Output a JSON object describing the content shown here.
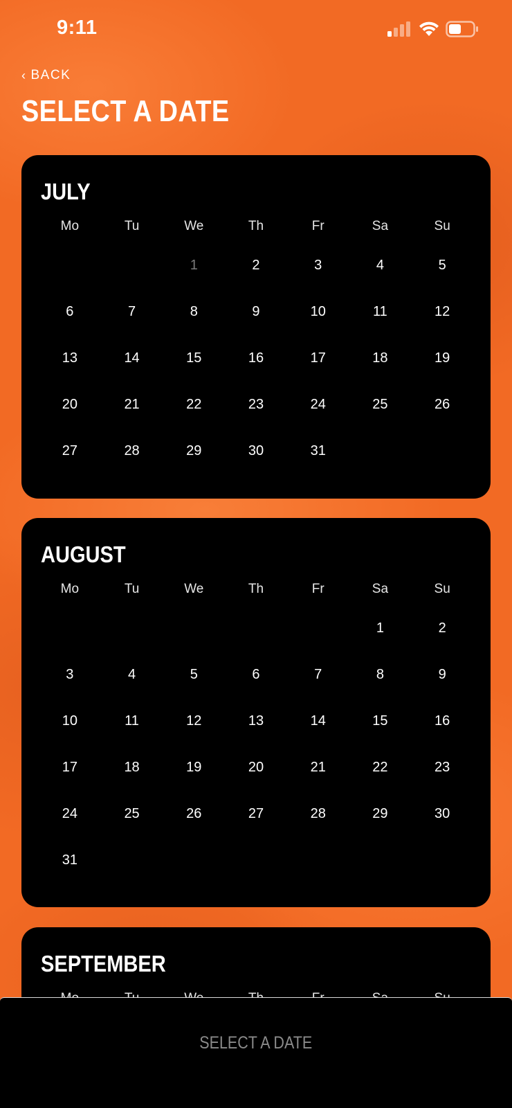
{
  "status_bar": {
    "time": "9:11",
    "icons": [
      "signal-icon",
      "wifi-icon",
      "battery-icon"
    ]
  },
  "header": {
    "back_chevron": "‹",
    "back_label": "BACK",
    "title": "SELECT A DATE"
  },
  "colors": {
    "background": "#f26a24",
    "card": "#000000",
    "text": "#ffffff",
    "disabled_day": "#7a7a7a",
    "cta_disabled_text": "#8a8a8a"
  },
  "weekday_labels": [
    "Mo",
    "Tu",
    "We",
    "Th",
    "Fr",
    "Sa",
    "Su"
  ],
  "months": [
    {
      "name": "JULY",
      "days": [
        "",
        "",
        "1",
        "2",
        "3",
        "4",
        "5",
        "6",
        "7",
        "8",
        "9",
        "10",
        "11",
        "12",
        "13",
        "14",
        "15",
        "16",
        "17",
        "18",
        "19",
        "20",
        "21",
        "22",
        "23",
        "24",
        "25",
        "26",
        "27",
        "28",
        "29",
        "30",
        "31",
        "",
        ""
      ],
      "disabled_days": [
        "1"
      ]
    },
    {
      "name": "AUGUST",
      "days": [
        "",
        "",
        "",
        "",
        "",
        "1",
        "2",
        "3",
        "4",
        "5",
        "6",
        "7",
        "8",
        "9",
        "10",
        "11",
        "12",
        "13",
        "14",
        "15",
        "16",
        "17",
        "18",
        "19",
        "20",
        "21",
        "22",
        "23",
        "24",
        "25",
        "26",
        "27",
        "28",
        "29",
        "30",
        "31",
        "",
        "",
        "",
        "",
        "",
        ""
      ],
      "disabled_days": []
    },
    {
      "name": "SEPTEMBER",
      "days": [],
      "disabled_days": []
    }
  ],
  "bottom_bar": {
    "button_label": "SELECT A DATE"
  }
}
